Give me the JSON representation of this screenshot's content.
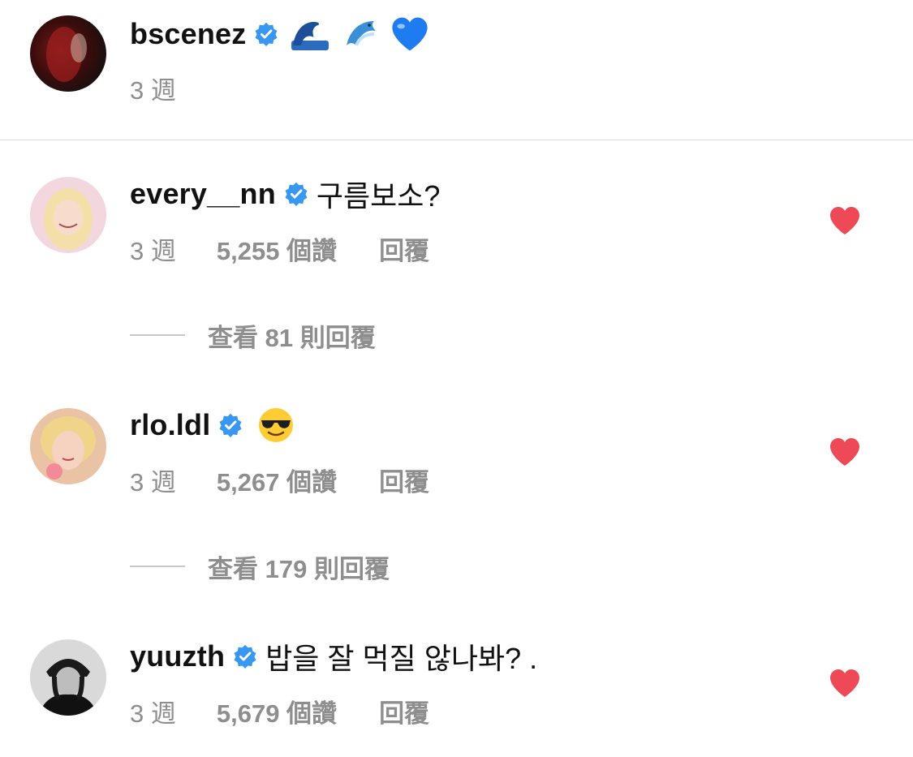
{
  "caption": {
    "username": "bscenez",
    "emojis": [
      "wave-emoji",
      "dolphin-emoji",
      "blue-heart-emoji"
    ],
    "age": "3 週"
  },
  "comments": [
    {
      "username": "every__nn",
      "text": "구름보소?",
      "age": "3 週",
      "likes": "5,255 個讚",
      "reply": "回覆",
      "view_replies": "查看 81 則回覆",
      "liked": true
    },
    {
      "username": "rlo.ldl",
      "emoji": "sunglasses-emoji",
      "age": "3 週",
      "likes": "5,267 個讚",
      "reply": "回覆",
      "view_replies": "查看 179 則回覆",
      "liked": true
    },
    {
      "username": "yuuzth",
      "text": "밥을 잘 먹질 않나봐? .",
      "age": "3 週",
      "likes": "5,679 個讚",
      "reply": "回覆",
      "liked": true
    }
  ],
  "colors": {
    "verified": "#3897f0",
    "heart": "#ed4956",
    "meta_text": "#8e8e8e",
    "divider": "#dbdbdb"
  }
}
